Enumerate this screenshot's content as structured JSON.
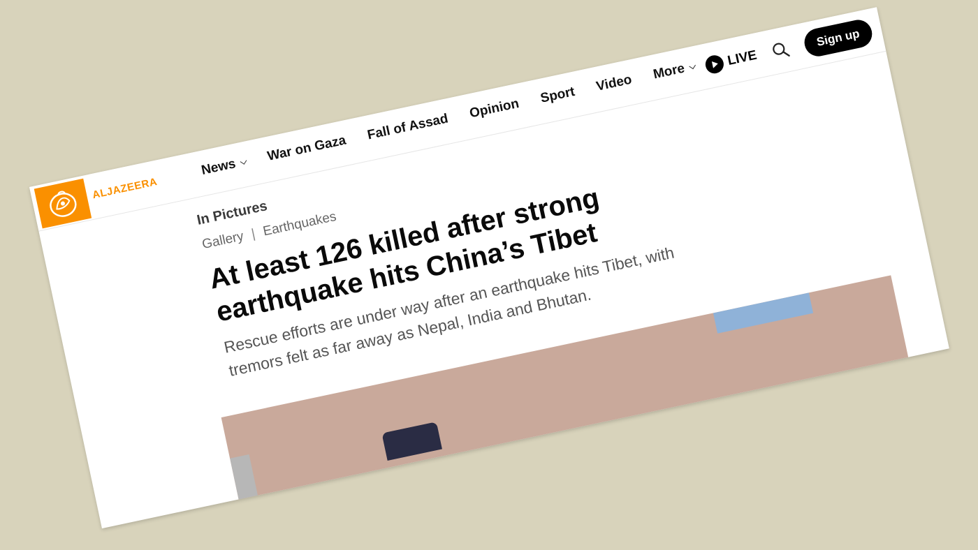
{
  "brand": {
    "name": "ALJAZEERA",
    "color": "#fa9000"
  },
  "nav": {
    "items": [
      {
        "label": "News",
        "dropdown": true
      },
      {
        "label": "War on Gaza",
        "dropdown": false
      },
      {
        "label": "Fall of Assad",
        "dropdown": false
      },
      {
        "label": "Opinion",
        "dropdown": false
      },
      {
        "label": "Sport",
        "dropdown": false
      },
      {
        "label": "Video",
        "dropdown": false
      },
      {
        "label": "More",
        "dropdown": true
      }
    ]
  },
  "tools": {
    "live_label": "LIVE",
    "search_icon": "search-icon",
    "signup_label": "Sign up"
  },
  "article": {
    "kicker": "In Pictures",
    "breadcrumb": [
      "Gallery",
      "Earthquakes"
    ],
    "breadcrumb_separator": "|",
    "headline": "At least 126 killed after strong earthquake hits China’s Tibet",
    "standfirst": "Rescue efforts are under way after an earthquake hits Tibet, with tremors felt as far away as Nepal, India and Bhutan."
  }
}
